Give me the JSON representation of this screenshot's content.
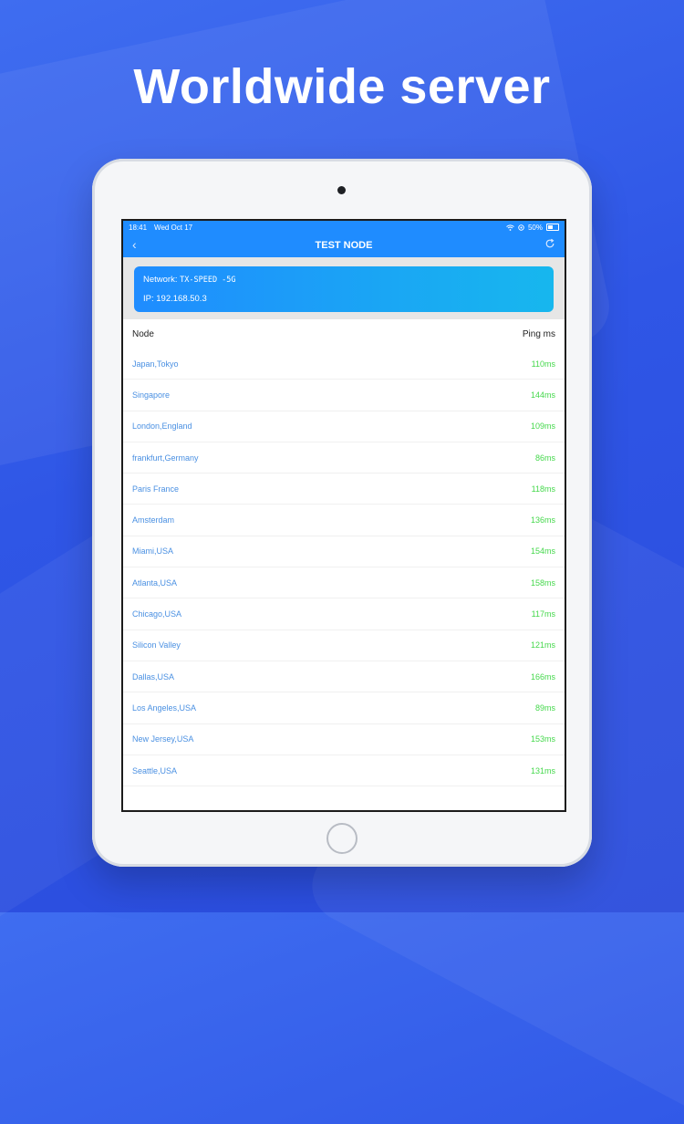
{
  "headline": "Worldwide server",
  "status_bar": {
    "time": "18:41",
    "date": "Wed Oct 17",
    "battery": "50%"
  },
  "nav": {
    "title": "TEST NODE",
    "back_icon": "chevron-left-icon",
    "refresh_icon": "refresh-icon"
  },
  "network": {
    "network_label": "Network:",
    "network_name": "TX-SPEED -5G",
    "ip_label": "IP:",
    "ip_value": "192.168.50.3"
  },
  "table": {
    "col_node": "Node",
    "col_ping": "Ping ms",
    "rows": [
      {
        "name": "Japan,Tokyo",
        "ping": "110ms"
      },
      {
        "name": "Singapore",
        "ping": "144ms"
      },
      {
        "name": "London,England",
        "ping": "109ms"
      },
      {
        "name": "frankfurt,Germany",
        "ping": "86ms"
      },
      {
        "name": "Paris France",
        "ping": "118ms"
      },
      {
        "name": "Amsterdam",
        "ping": "136ms"
      },
      {
        "name": "Miami,USA",
        "ping": "154ms"
      },
      {
        "name": "Atlanta,USA",
        "ping": "158ms"
      },
      {
        "name": "Chicago,USA",
        "ping": "117ms"
      },
      {
        "name": "Silicon Valley",
        "ping": "121ms"
      },
      {
        "name": "Dallas,USA",
        "ping": "166ms"
      },
      {
        "name": "Los Angeles,USA",
        "ping": "89ms"
      },
      {
        "name": "New Jersey,USA",
        "ping": "153ms"
      },
      {
        "name": "Seattle,USA",
        "ping": "131ms"
      }
    ]
  },
  "colors": {
    "primary": "#1f8cff",
    "node_text": "#4a90e2",
    "ping_text": "#45d84c",
    "background": "#2f56e6"
  }
}
